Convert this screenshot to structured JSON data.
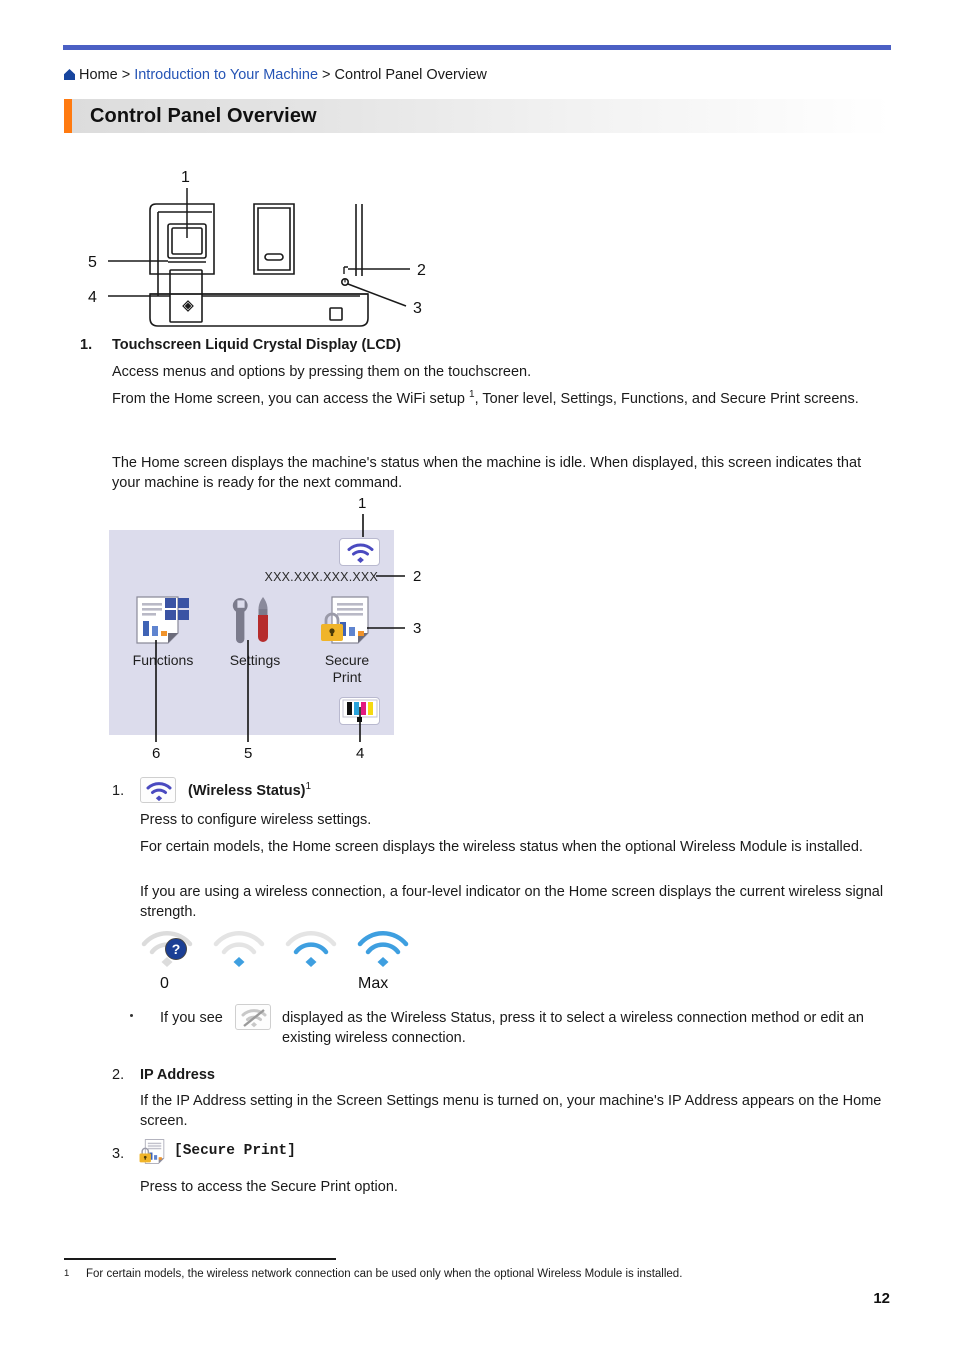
{
  "breadcrumb": {
    "home_icon": "home-icon",
    "home": "Home",
    "sep": ">",
    "link": "Introduction to Your Machine",
    "sep2": ">",
    "current": "Control Panel Overview"
  },
  "page": {
    "title": "Control Panel Overview",
    "number": "12",
    "accent_color": "#ff7a10",
    "rule_color": "#4b60c4",
    "link_color": "#2554b5"
  },
  "machine_figure": {
    "callouts": [
      "1",
      "5",
      "4",
      "2",
      "3"
    ]
  },
  "item1": {
    "number": "1.",
    "label": "Touchscreen Liquid Crystal Display (LCD)",
    "para1": "Access menus and options by pressing them on the touchscreen.",
    "para2_before": "From the Home screen, you can access the WiFi setup ",
    "para2_footnote": "1",
    "para2_after": ", Toner level, Settings, Functions, and Secure Print screens.",
    "para3": "The Home screen displays the machine's status when the machine is idle. When displayed, this screen indicates that your machine is ready for the next command."
  },
  "lcd": {
    "ip_address": "XXX.XXX.XXX.XXX",
    "wifi_icon": "wifi-icon",
    "toner_icon": "toner-level-icon",
    "tiles": [
      {
        "label": "Functions",
        "icon": "functions-icon"
      },
      {
        "label": "Settings",
        "icon": "settings-tools-icon"
      },
      {
        "label": "Secure\nPrint",
        "label_line1": "Secure",
        "label_line2": "Print",
        "icon": "secure-print-icon"
      }
    ],
    "callouts": {
      "top": "1",
      "ip": "2",
      "secure": "3",
      "toner": "4",
      "settings": "5",
      "functions": "6"
    },
    "background_color": "#dcdcec"
  },
  "detail1": {
    "number": "1.",
    "icon": "wireless-status-icon",
    "label": "(Wireless Status)",
    "footnote": "1",
    "para1": "Press to configure wireless settings.",
    "para2": "For certain models, the Home screen displays the wireless status when the optional Wireless Module is installed.",
    "para3": "If you are using a wireless connection, a four-level indicator on the Home screen displays the current wireless signal strength.",
    "signal": {
      "min_label": "0",
      "max_label": "Max",
      "levels": [
        "level-0-unknown",
        "level-1",
        "level-2",
        "level-3-max"
      ]
    },
    "bullet_before": "If you see",
    "bullet_icon": "wireless-disabled-icon",
    "bullet_after": "displayed as the Wireless Status, press it to select a wireless connection method or edit an existing wireless connection."
  },
  "detail2": {
    "number": "2.",
    "label": "IP Address",
    "para1": "If the IP Address setting in the Screen Settings menu is turned on, your machine's IP Address appears on the Home screen."
  },
  "detail3": {
    "number": "3.",
    "icon": "secure-print-icon",
    "label": "[Secure Print]",
    "para1": "Press to access the Secure Print option."
  },
  "footnote": {
    "marker": "1",
    "text": "For certain models, the wireless network connection can be used only when the optional Wireless Module is installed."
  }
}
